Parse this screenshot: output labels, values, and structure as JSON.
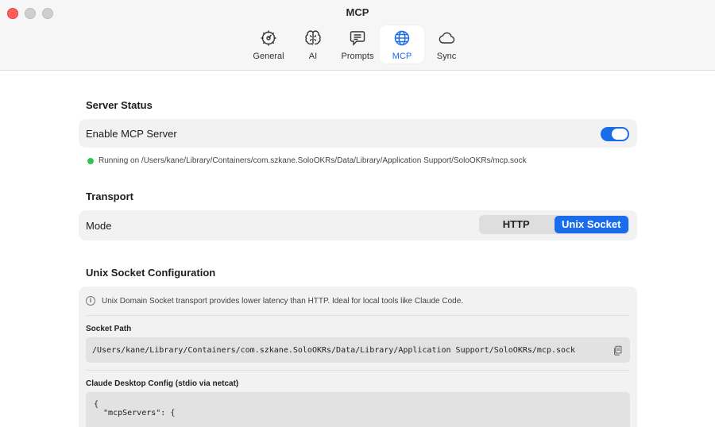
{
  "window": {
    "title": "MCP"
  },
  "toolbar": {
    "tabs": [
      {
        "label": "General",
        "icon": "gear-icon"
      },
      {
        "label": "AI",
        "icon": "brain-icon"
      },
      {
        "label": "Prompts",
        "icon": "speech-bubble-icon"
      },
      {
        "label": "MCP",
        "icon": "globe-icon",
        "active": true
      },
      {
        "label": "Sync",
        "icon": "cloud-icon"
      }
    ]
  },
  "server_status": {
    "title": "Server Status",
    "enable_label": "Enable MCP Server",
    "enabled": true,
    "status_text": "Running on /Users/kane/Library/Containers/com.szkane.SoloOKRs/Data/Library/Application Support/SoloOKRs/mcp.sock",
    "status_color": "#30c552"
  },
  "transport": {
    "title": "Transport",
    "mode_label": "Mode",
    "options": [
      "HTTP",
      "Unix Socket"
    ],
    "selected": "Unix Socket"
  },
  "unix_socket": {
    "title": "Unix Socket Configuration",
    "info_text": "Unix Domain Socket transport provides lower latency than HTTP. Ideal for local tools like Claude Code.",
    "socket_path_label": "Socket Path",
    "socket_path": "/Users/kane/Library/Containers/com.szkane.SoloOKRs/Data/Library/Application Support/SoloOKRs/mcp.sock",
    "claude_config_label": "Claude Desktop Config (stdio via netcat)",
    "config_line1": "{",
    "config_line2": "  \"mcpServers\": {"
  },
  "colors": {
    "accent": "#1a6dea",
    "close": "#ff5f57"
  }
}
